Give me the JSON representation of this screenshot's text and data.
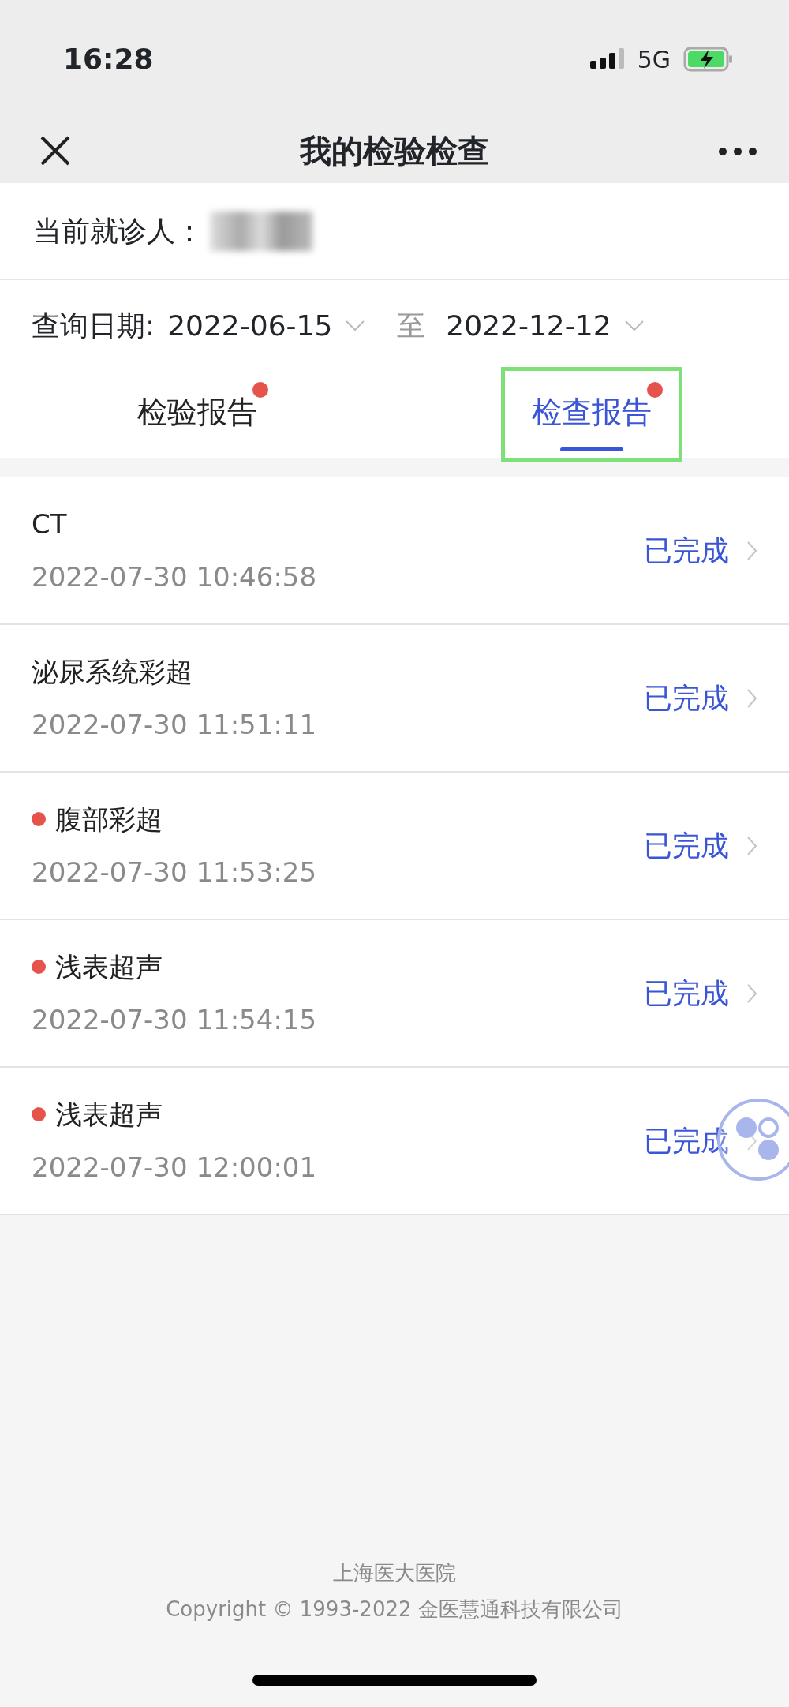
{
  "status_bar": {
    "time": "16:28",
    "network": "5G"
  },
  "nav_bar": {
    "title": "我的检验检查"
  },
  "patient": {
    "label": "当前就诊人：",
    "name_hidden": true
  },
  "date_filter": {
    "label": "查询日期:",
    "start": "2022-06-15",
    "separator": "至",
    "end": "2022-12-12"
  },
  "tabs": [
    {
      "label": "检验报告",
      "selected": false,
      "unread": true,
      "highlighted": false
    },
    {
      "label": "检查报告",
      "selected": true,
      "unread": true,
      "highlighted": true
    }
  ],
  "reports": [
    {
      "name": "CT",
      "time": "2022-07-30 10:46:58",
      "status": "已完成",
      "unread": false
    },
    {
      "name": "泌尿系统彩超",
      "time": "2022-07-30 11:51:11",
      "status": "已完成",
      "unread": false
    },
    {
      "name": "腹部彩超",
      "time": "2022-07-30 11:53:25",
      "status": "已完成",
      "unread": true
    },
    {
      "name": "浅表超声",
      "time": "2022-07-30 11:54:15",
      "status": "已完成",
      "unread": true
    },
    {
      "name": "浅表超声",
      "time": "2022-07-30 12:00:01",
      "status": "已完成",
      "unread": true
    }
  ],
  "footer": {
    "hospital": "上海医大医院",
    "copyright": "Copyright © 1993-2022 金医慧通科技有限公司"
  }
}
